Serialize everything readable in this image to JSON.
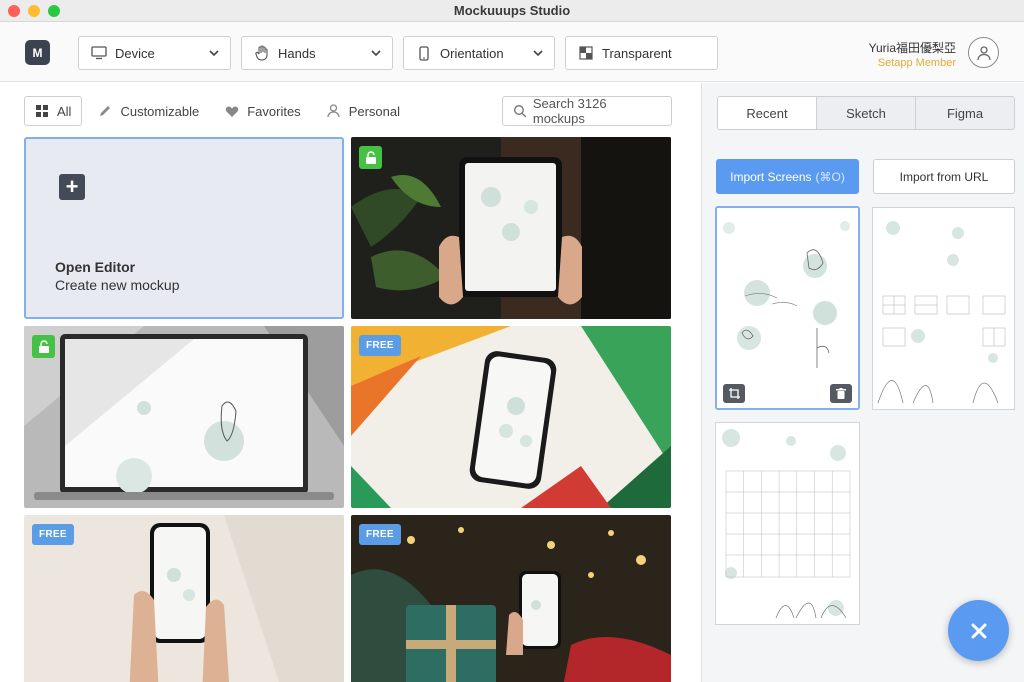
{
  "window": {
    "title": "Mockuuups Studio"
  },
  "logo": {
    "letter": "M"
  },
  "toolbar": {
    "device": {
      "label": "Device",
      "icon": "monitor-icon"
    },
    "hands": {
      "label": "Hands",
      "icon": "hand-icon"
    },
    "orientation": {
      "label": "Orientation",
      "icon": "phone-icon"
    },
    "background": {
      "label": "Transparent",
      "icon": "checkerboard-icon"
    }
  },
  "user": {
    "name": "Yuria福田優梨亞",
    "plan": "Setapp Member"
  },
  "filters": [
    {
      "label": "All",
      "icon": "grid-icon",
      "active": true
    },
    {
      "label": "Customizable",
      "icon": "pencil-icon"
    },
    {
      "label": "Favorites",
      "icon": "heart-icon"
    },
    {
      "label": "Personal",
      "icon": "person-icon"
    }
  ],
  "search": {
    "placeholder": "Search 3126 mockups"
  },
  "editor_card": {
    "title": "Open Editor",
    "subtitle": "Create new mockup"
  },
  "mockups": [
    {
      "kind": "tablet-hands",
      "badge": "unlocked"
    },
    {
      "kind": "laptop",
      "badge": "unlocked"
    },
    {
      "kind": "phone-colorful",
      "badge": "FREE"
    },
    {
      "kind": "phone-hands",
      "badge": "FREE"
    },
    {
      "kind": "phone-gift",
      "badge": "FREE"
    }
  ],
  "panel": {
    "tabs": [
      "Recent",
      "Sketch",
      "Figma"
    ],
    "active_tab": "Recent",
    "import_label": "Import Screens",
    "import_shortcut": "(⌘O)",
    "url_label": "Import from URL"
  },
  "colors": {
    "accent": "#5a9bf1",
    "member": "#e8a93a",
    "free_badge": "#5a9de6",
    "unlock_badge": "#45c146"
  }
}
